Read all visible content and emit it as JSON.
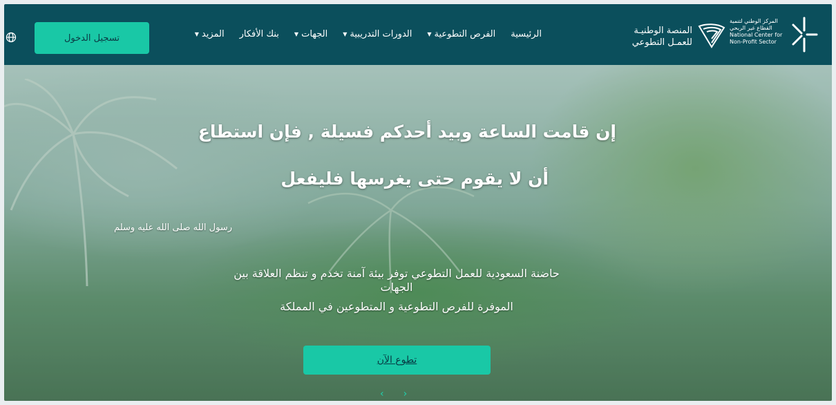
{
  "header": {
    "logo": {
      "center_name_ar": "المركز الوطني لتنمية القطاع غير الربحي",
      "center_name_en": "National Center for Non-Profit Sector",
      "platform_line1": "المنصة الوطنيـة",
      "platform_line2": "للعمـل التطوعي"
    },
    "nav": {
      "home": "الرئيسية",
      "opportunities": "الفرص التطوعية",
      "courses": "الدورات التدريبية",
      "entities": "الجهات",
      "ideas_bank": "بنك الأفكار",
      "more": "المزيد"
    },
    "login_label": "تسجيل الدخول",
    "colors": {
      "bar": "#0b4f5c",
      "accent": "#19c8a6"
    }
  },
  "hero": {
    "quote_line1": "إن قامت الساعة وبيد أحدكم فسيلة , فإن استطاع",
    "quote_line2": "أن لا يقوم حتى يغرسها فليفعل",
    "attribution": "رسول الله صلى الله عليه وسلم",
    "desc_line1": "حاضنة السعودية للعمل التطوعي توفر بيئة آمنة تخدم و تنظم العلاقة بين",
    "desc_line2": "الجهات",
    "desc_line3": "الموفرة للفرص التطوعية و المتطوعين في المملكة",
    "cta_label": "تطوع الآن",
    "arrow_prev": "‹",
    "arrow_next": "›"
  }
}
